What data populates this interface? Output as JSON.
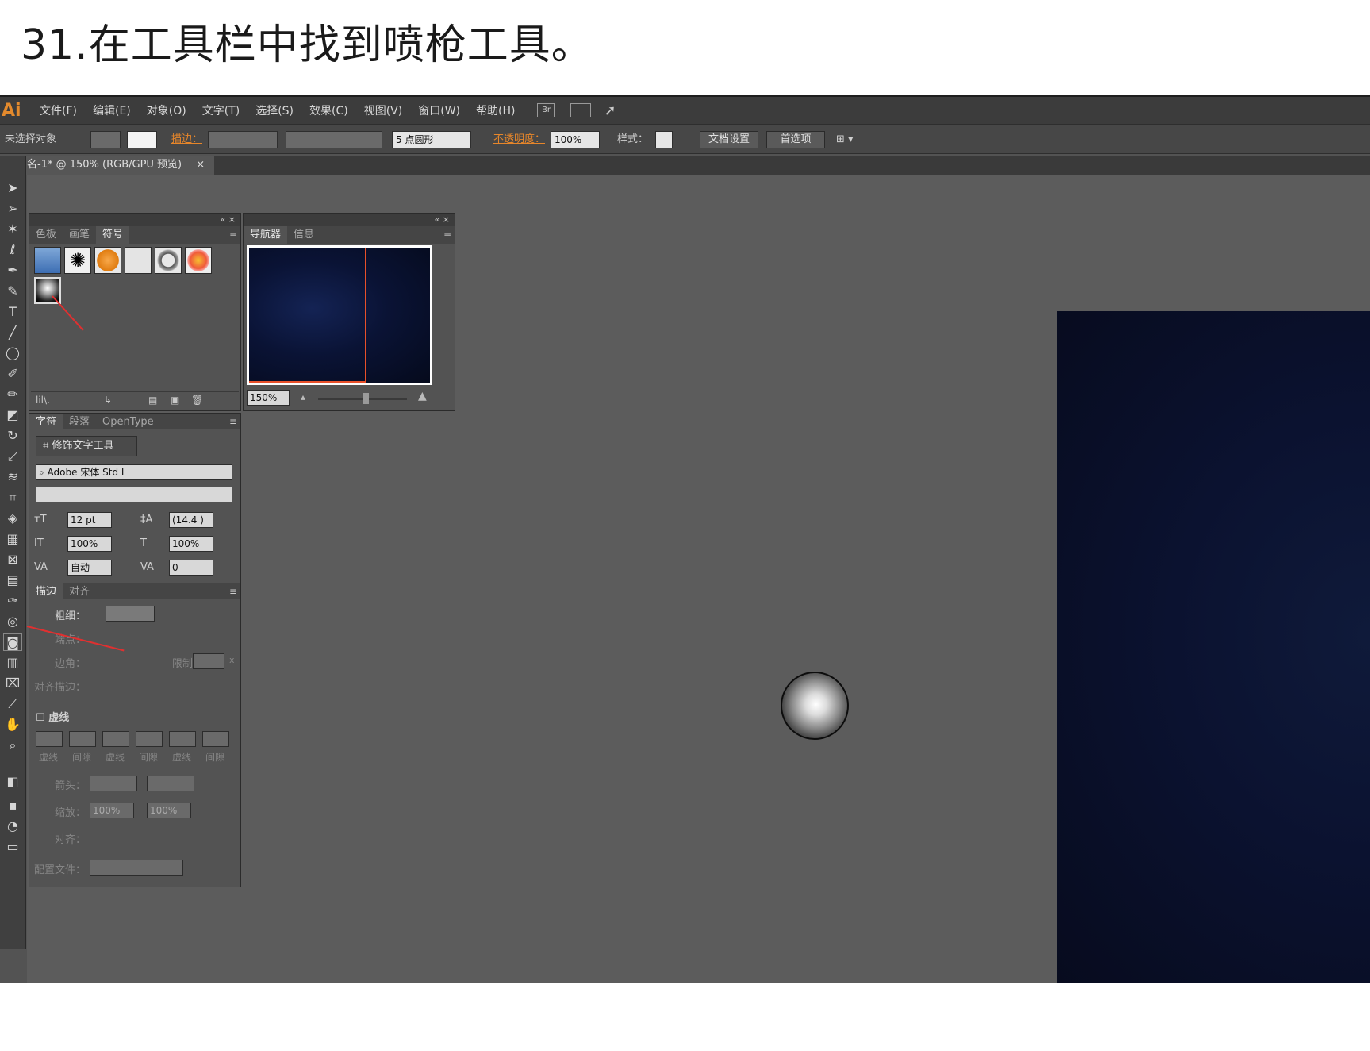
{
  "caption": "31.在工具栏中找到喷枪工具。",
  "menubar": {
    "logo": "Ai",
    "items": [
      "文件(F)",
      "编辑(E)",
      "对象(O)",
      "文字(T)",
      "选择(S)",
      "效果(C)",
      "视图(V)",
      "窗口(W)",
      "帮助(H)"
    ],
    "br_label": "Br"
  },
  "controlbar": {
    "no_selection": "未选择对象",
    "stroke_label": "描边：",
    "brush_value": "5 点圆形",
    "opacity_label": "不透明度：",
    "opacity_value": "100%",
    "style_label": "样式：",
    "doc_setup": "文档设置",
    "preferences": "首选项"
  },
  "document_tab": {
    "title": "名-1* @ 150% (RGB/GPU 预览)",
    "close": "×"
  },
  "symbols_panel": {
    "tabs": [
      "色板",
      "画笔",
      "符号"
    ],
    "active_tab": "符号",
    "library_label": "lil\\."
  },
  "navigator_panel": {
    "tabs": [
      "导航器",
      "信息"
    ],
    "active_tab": "导航器",
    "zoom": "150%"
  },
  "character_panel": {
    "tabs": [
      "字符",
      "段落",
      "OpenType"
    ],
    "touch_type_button": "修饰文字工具",
    "font_family": "Adobe 宋体 Std L",
    "font_style": "-",
    "font_size": "12 pt",
    "leading": "(14.4 )",
    "vertical_scale": "100%",
    "horizontal_scale": "100%",
    "kerning": "自动",
    "tracking": "0"
  },
  "stroke_panel": {
    "tabs": [
      "描边",
      "对齐"
    ],
    "weight_label": "粗细：",
    "cap_label": "端点：",
    "corner_label": "边角：",
    "limit_label": "限制：",
    "limit_unit": "x",
    "align_label": "对齐描边：",
    "dashed_label": "虚线",
    "dash_labels": [
      "虚线",
      "间隙",
      "虚线",
      "间隙",
      "虚线",
      "间隙"
    ],
    "arrow_label": "箭头：",
    "scale_label": "缩放：",
    "scale_value_1": "100%",
    "scale_value_2": "100%",
    "align2_label": "对齐：",
    "profile_label": "配置文件："
  }
}
